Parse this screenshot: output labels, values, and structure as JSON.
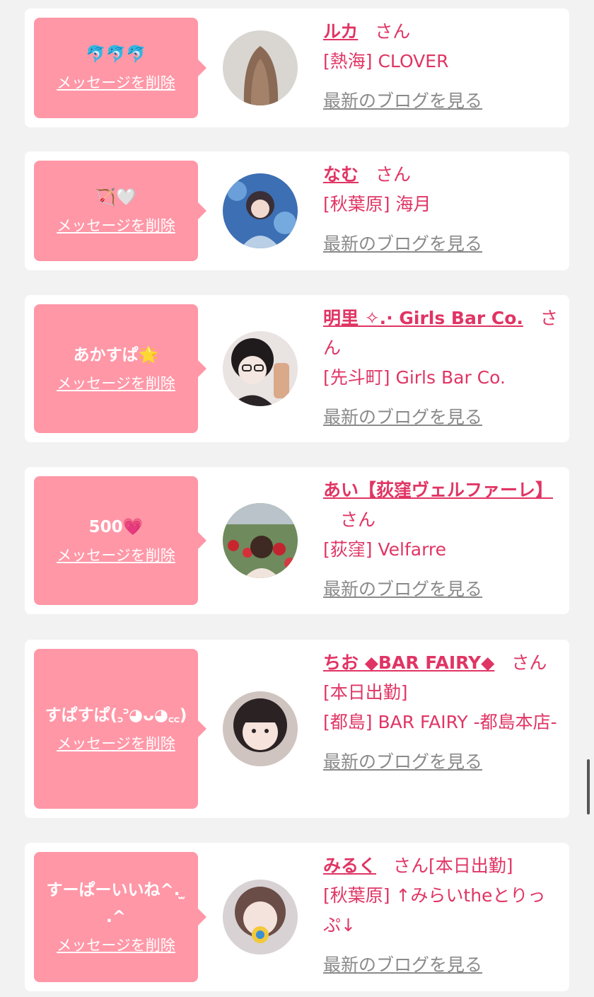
{
  "delete_label": "メッセージを削除",
  "blog_label": "最新のブログを見る",
  "san_suffix": "さん",
  "colors": {
    "accent": "#e03564",
    "bubble": "#ff97a7",
    "link_gray": "#8a8a8a",
    "background": "#f2f2f2"
  },
  "entries": [
    {
      "message": "🐬🐬🐬",
      "name": "ルカ",
      "shop": "[熱海] CLOVER",
      "avatar_icon": "profile-photo-icon"
    },
    {
      "message": "🏹🤍",
      "name": "なむ",
      "shop": "[秋葉原] 海月",
      "avatar_icon": "profile-photo-icon"
    },
    {
      "message": "あかすぱ🌟",
      "name": "明里 ✧.· Girls Bar Co.",
      "shop": "[先斗町] Girls Bar Co.",
      "avatar_icon": "profile-photo-icon"
    },
    {
      "message": "500💗",
      "name": "あい【荻窪ヴェルファーレ】",
      "shop": "[荻窪] Velfarre",
      "avatar_icon": "profile-photo-icon"
    },
    {
      "message": "すぱすぱ(꜆꜄◕ᴗ◕꜀꜀)",
      "name": "ちお ◆BAR FAIRY◆",
      "status": "[本日出勤]",
      "shop": "[都島] BAR FAIRY -都島本店-",
      "avatar_icon": "profile-photo-icon"
    },
    {
      "message": "すーぱーいいね^. ̫ .^",
      "name": "みるく",
      "status": "[本日出勤]",
      "shop": "[秋葉原] ↑みらいtheとりっぷ↓",
      "avatar_icon": "profile-photo-icon"
    }
  ]
}
